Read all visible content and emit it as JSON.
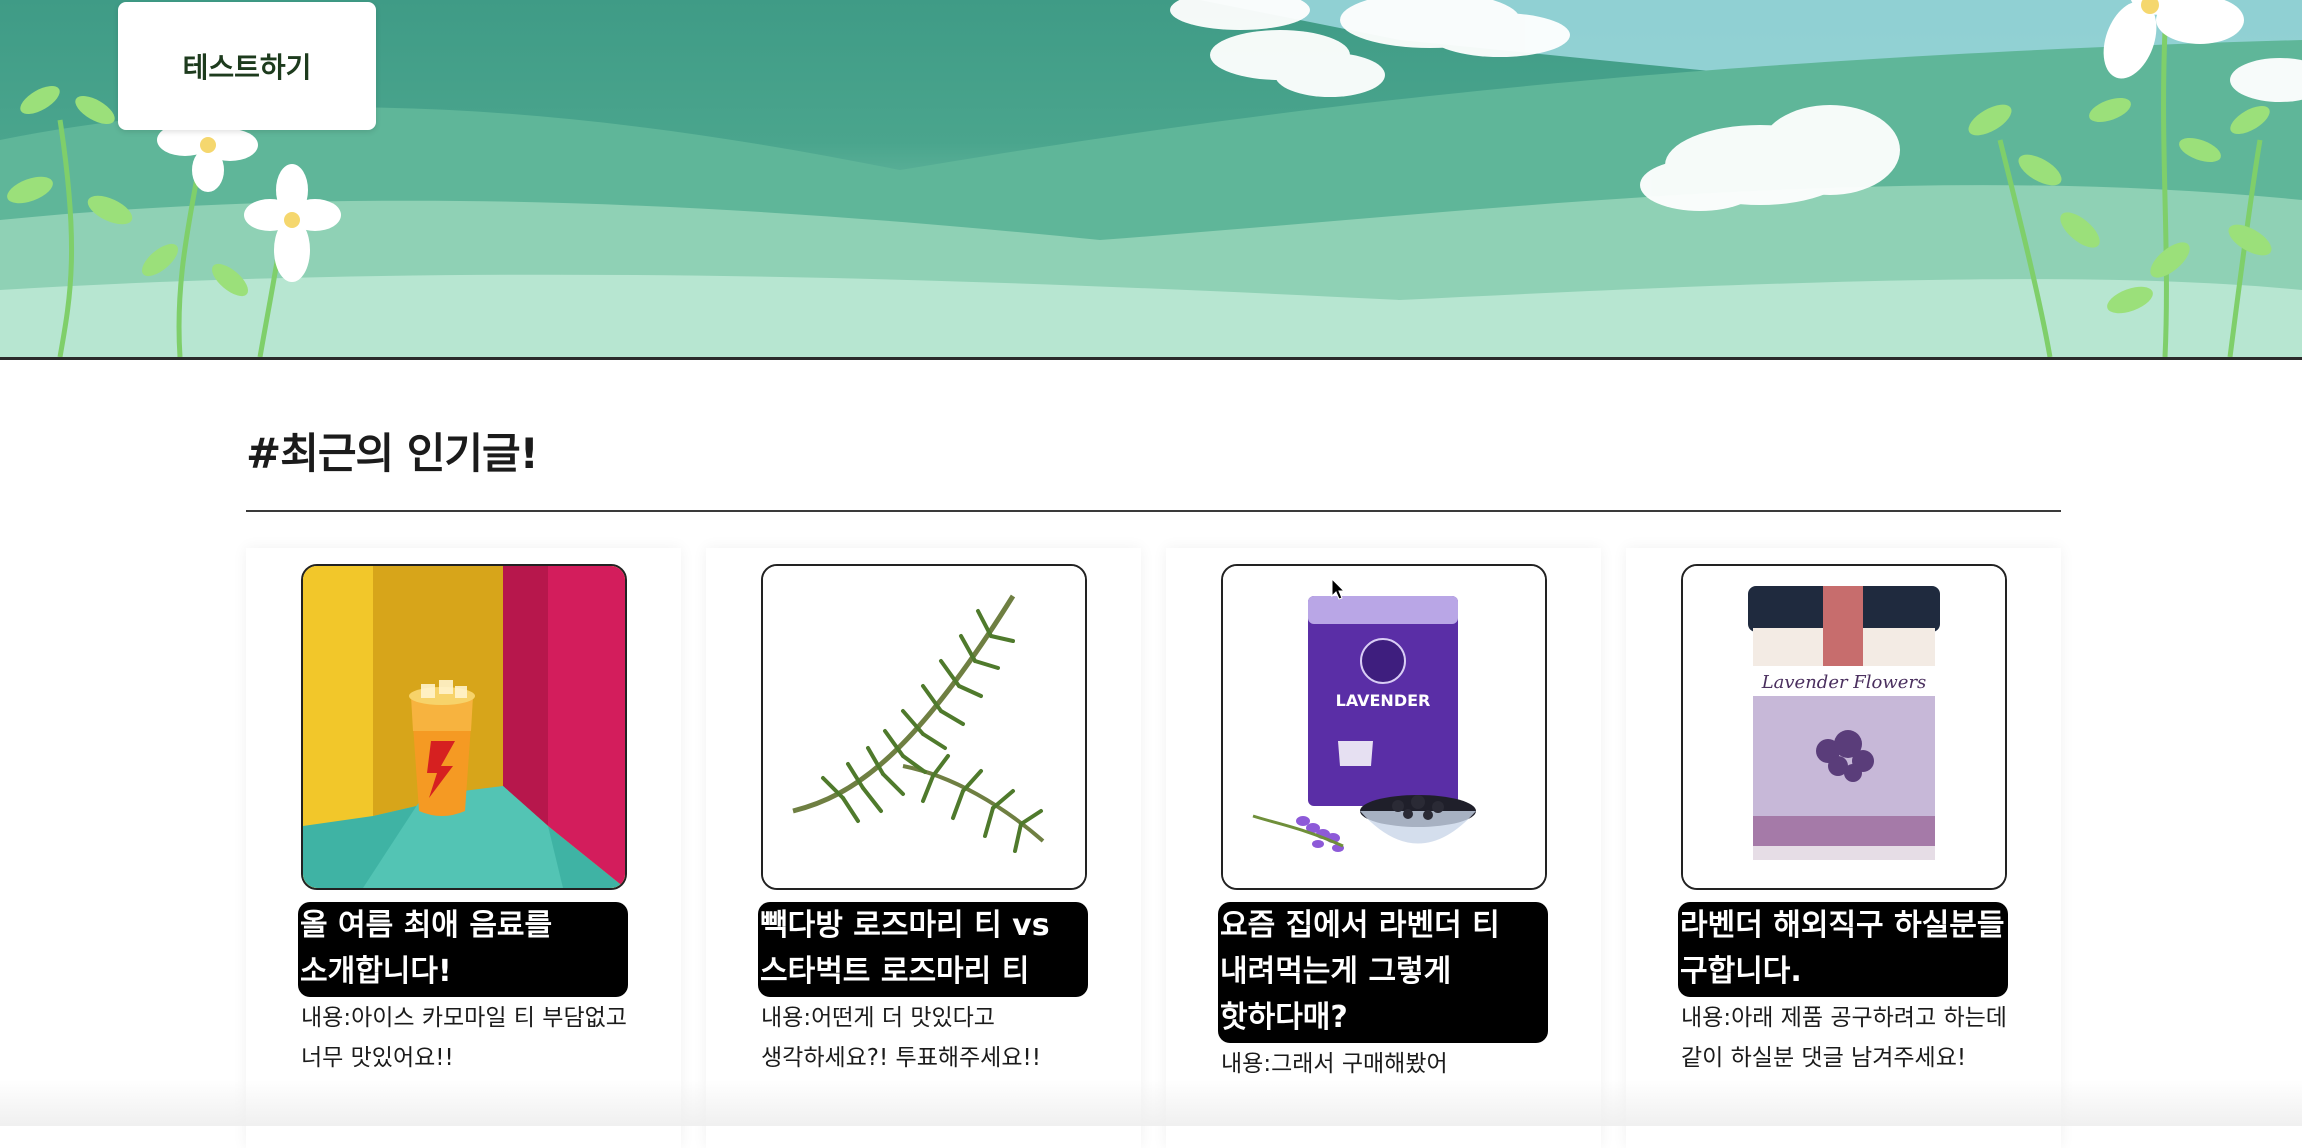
{
  "header": {
    "test_button_label": "테스트하기"
  },
  "section": {
    "title": "#최근의 인기글!"
  },
  "cards": [
    {
      "title": "올 여름 최애 음료를 소개합니다!",
      "description": "내용:아이스 카모마일 티 부담없고 너무 맛있어요!!",
      "image_icon": "iced-drink-image"
    },
    {
      "title": "빽다방 로즈마리 티 vs 스타벅트 로즈마리 티",
      "description": "내용:어떤게 더 맛있다고 생각하세요?! 투표해주세요!!",
      "image_icon": "rosemary-image"
    },
    {
      "title": "요즘 집에서 라벤더 티 내려먹는게 그렇게 핫하다매?",
      "description": "내용:그래서 구매해봤어",
      "image_icon": "lavender-tea-pack-image",
      "package_text": "LAVENDER"
    },
    {
      "title": "라벤더 해외직구 하실분들 구합니다.",
      "description": "내용:아래 제품 공구하려고 하는데 같이 하실분 댓글 남겨주세요!",
      "image_icon": "lavender-tea-tin-image",
      "tin_text": "Lavender Flowers"
    }
  ],
  "colors": {
    "banner_green": "#4aa58d",
    "title_black": "#000000"
  }
}
